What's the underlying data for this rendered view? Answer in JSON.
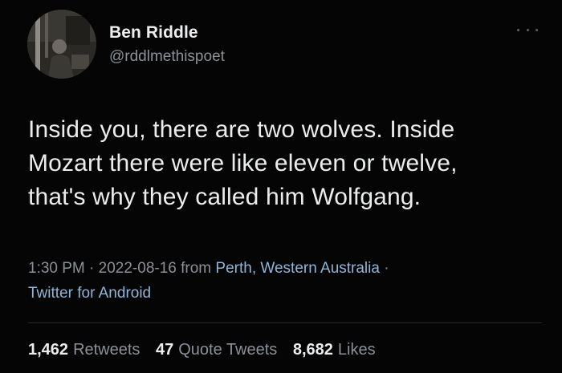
{
  "user": {
    "display_name": "Ben Riddle",
    "handle": "@rddlmethispoet"
  },
  "tweet": {
    "text": "Inside you, there are two wolves. Inside\nMozart there were like eleven or twelve,\nthat's why they called him Wolfgang."
  },
  "meta": {
    "time": "1:30 PM",
    "separator": " · ",
    "date": "2022-08-16",
    "from_word": " from ",
    "location": "Perth, Western Australia",
    "separator2": " ·",
    "source": "Twitter for Android"
  },
  "stats": {
    "retweets_count": "1,462",
    "retweets_label": "Retweets",
    "quotes_count": "47",
    "quotes_label": "Quote Tweets",
    "likes_count": "8,682",
    "likes_label": "Likes"
  },
  "icons": {
    "more": "more-horizontal-icon"
  },
  "colors": {
    "background": "#050505",
    "primary_text": "#ebeced",
    "secondary_text": "#8b9196",
    "link": "#8fb5d8"
  }
}
